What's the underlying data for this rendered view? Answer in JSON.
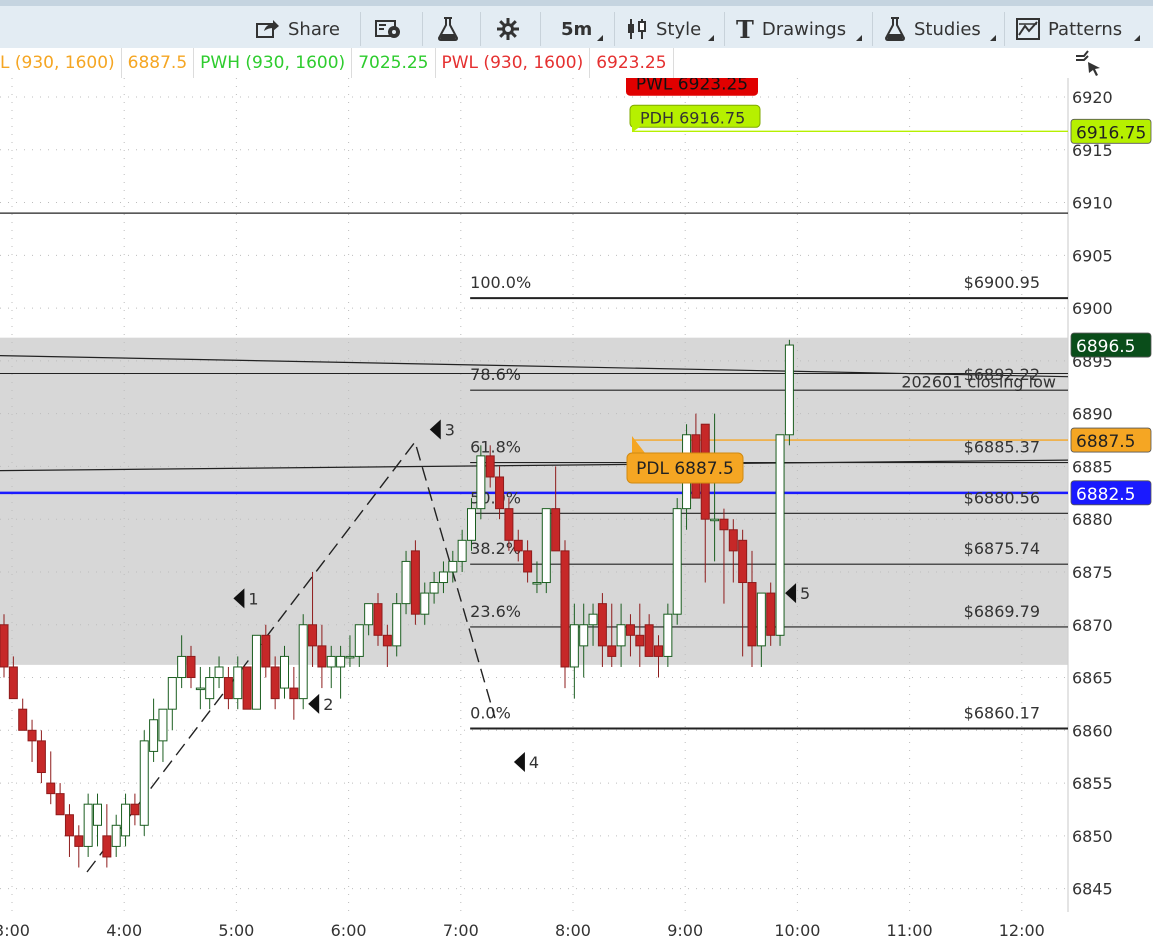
{
  "toolbar": {
    "share": "Share",
    "timeframe": "5m",
    "style": "Style",
    "drawings": "Drawings",
    "studies": "Studies",
    "patterns": "Patterns",
    "icons": [
      "share-icon",
      "screenshot-icon",
      "flask-icon",
      "gear-icon",
      "candles-icon",
      "text-T-icon",
      "flask-icon",
      "patterns-icon"
    ]
  },
  "study_labels": {
    "pdl_label": "L (930, 1600)",
    "pdl_value": "6887.5",
    "pwh_label": "PWH (930, 1600)",
    "pwh_value": "7025.25",
    "pwl_label": "PWL (930, 1600)",
    "pwl_value": "6923.25"
  },
  "colors": {
    "up_candle": "#2e7d32",
    "down_candle": "#c62828",
    "pdl": "#f5a623",
    "pwh": "#b6f000",
    "pwl": "#e00000",
    "blue_line": "#1a1aff",
    "last_price": "#0a4d1a",
    "zone": "#d0d0d0"
  },
  "chart_data": {
    "type": "candlestick",
    "ylim": [
      6843,
      6922
    ],
    "y_ticks": [
      6845,
      6850,
      6855,
      6860,
      6865,
      6870,
      6875,
      6880,
      6885,
      6890,
      6895,
      6900,
      6905,
      6910,
      6915,
      6920
    ],
    "x_ticks": [
      "3:00",
      "4:00",
      "5:00",
      "6:00",
      "7:00",
      "8:00",
      "9:00",
      "10:00",
      "11:00",
      "12:00"
    ],
    "candles": [
      {
        "o": 6870,
        "h": 6871,
        "l": 6865,
        "c": 6866
      },
      {
        "o": 6866,
        "h": 6867,
        "l": 6863,
        "c": 6863
      },
      {
        "o": 6862,
        "h": 6863,
        "l": 6860,
        "c": 6860
      },
      {
        "o": 6860,
        "h": 6861,
        "l": 6857,
        "c": 6859
      },
      {
        "o": 6859,
        "h": 6860,
        "l": 6855,
        "c": 6856
      },
      {
        "o": 6855,
        "h": 6858,
        "l": 6853,
        "c": 6854
      },
      {
        "o": 6854,
        "h": 6855,
        "l": 6852,
        "c": 6852
      },
      {
        "o": 6852,
        "h": 6853,
        "l": 6848,
        "c": 6850
      },
      {
        "o": 6850,
        "h": 6851,
        "l": 6847,
        "c": 6849
      },
      {
        "o": 6849,
        "h": 6854,
        "l": 6848,
        "c": 6853
      },
      {
        "o": 6851,
        "h": 6854,
        "l": 6849,
        "c": 6853
      },
      {
        "o": 6850,
        "h": 6853,
        "l": 6847,
        "c": 6848
      },
      {
        "o": 6849,
        "h": 6852,
        "l": 6848,
        "c": 6851
      },
      {
        "o": 6850,
        "h": 6854,
        "l": 6849,
        "c": 6853
      },
      {
        "o": 6853,
        "h": 6854,
        "l": 6851,
        "c": 6852
      },
      {
        "o": 6851,
        "h": 6860,
        "l": 6850,
        "c": 6859
      },
      {
        "o": 6858,
        "h": 6863,
        "l": 6857,
        "c": 6861
      },
      {
        "o": 6859,
        "h": 6862,
        "l": 6857,
        "c": 6862
      },
      {
        "o": 6862,
        "h": 6865,
        "l": 6860,
        "c": 6865
      },
      {
        "o": 6865,
        "h": 6869,
        "l": 6864,
        "c": 6867
      },
      {
        "o": 6867,
        "h": 6868,
        "l": 6864,
        "c": 6865
      },
      {
        "o": 6864,
        "h": 6866,
        "l": 6862,
        "c": 6864
      },
      {
        "o": 6863,
        "h": 6866,
        "l": 6862,
        "c": 6865
      },
      {
        "o": 6865,
        "h": 6867,
        "l": 6864,
        "c": 6866
      },
      {
        "o": 6865,
        "h": 6866,
        "l": 6862,
        "c": 6863
      },
      {
        "o": 6863,
        "h": 6867,
        "l": 6862,
        "c": 6866
      },
      {
        "o": 6866,
        "h": 6866,
        "l": 6862,
        "c": 6862
      },
      {
        "o": 6862,
        "h": 6869,
        "l": 6862,
        "c": 6869
      },
      {
        "o": 6869,
        "h": 6870,
        "l": 6865,
        "c": 6866
      },
      {
        "o": 6866,
        "h": 6867,
        "l": 6862,
        "c": 6863
      },
      {
        "o": 6864,
        "h": 6868,
        "l": 6863,
        "c": 6867
      },
      {
        "o": 6864,
        "h": 6866,
        "l": 6861,
        "c": 6863
      },
      {
        "o": 6863,
        "h": 6871,
        "l": 6862,
        "c": 6870
      },
      {
        "o": 6870,
        "h": 6875,
        "l": 6866,
        "c": 6868
      },
      {
        "o": 6868,
        "h": 6870,
        "l": 6864,
        "c": 6866
      },
      {
        "o": 6866,
        "h": 6868,
        "l": 6864,
        "c": 6867
      },
      {
        "o": 6866,
        "h": 6868,
        "l": 6863,
        "c": 6867
      },
      {
        "o": 6867,
        "h": 6869,
        "l": 6866,
        "c": 6867
      },
      {
        "o": 6867,
        "h": 6870,
        "l": 6866,
        "c": 6870
      },
      {
        "o": 6870,
        "h": 6872,
        "l": 6869,
        "c": 6872
      },
      {
        "o": 6872,
        "h": 6873,
        "l": 6868,
        "c": 6869
      },
      {
        "o": 6869,
        "h": 6870,
        "l": 6866,
        "c": 6868
      },
      {
        "o": 6868,
        "h": 6873,
        "l": 6867,
        "c": 6872
      },
      {
        "o": 6872,
        "h": 6877,
        "l": 6871,
        "c": 6876
      },
      {
        "o": 6877,
        "h": 6878,
        "l": 6870,
        "c": 6871
      },
      {
        "o": 6871,
        "h": 6874,
        "l": 6870,
        "c": 6873
      },
      {
        "o": 6873,
        "h": 6875,
        "l": 6872,
        "c": 6874
      },
      {
        "o": 6874,
        "h": 6876,
        "l": 6873,
        "c": 6875
      },
      {
        "o": 6875,
        "h": 6877,
        "l": 6874,
        "c": 6876
      },
      {
        "o": 6876,
        "h": 6879,
        "l": 6875,
        "c": 6878
      },
      {
        "o": 6878,
        "h": 6882,
        "l": 6877,
        "c": 6881
      },
      {
        "o": 6881,
        "h": 6887,
        "l": 6880,
        "c": 6886
      },
      {
        "o": 6886,
        "h": 6887,
        "l": 6883,
        "c": 6884
      },
      {
        "o": 6884,
        "h": 6885,
        "l": 6880,
        "c": 6881
      },
      {
        "o": 6881,
        "h": 6882,
        "l": 6877,
        "c": 6878
      },
      {
        "o": 6878,
        "h": 6879,
        "l": 6876,
        "c": 6877
      },
      {
        "o": 6877,
        "h": 6878,
        "l": 6874,
        "c": 6875
      },
      {
        "o": 6874,
        "h": 6876,
        "l": 6873,
        "c": 6874
      },
      {
        "o": 6874,
        "h": 6881,
        "l": 6873,
        "c": 6881
      },
      {
        "o": 6881,
        "h": 6885,
        "l": 6877,
        "c": 6877
      },
      {
        "o": 6877,
        "h": 6878,
        "l": 6864,
        "c": 6866
      },
      {
        "o": 6866,
        "h": 6872,
        "l": 6863,
        "c": 6870
      },
      {
        "o": 6868,
        "h": 6872,
        "l": 6865,
        "c": 6870
      },
      {
        "o": 6870,
        "h": 6872,
        "l": 6868,
        "c": 6871
      },
      {
        "o": 6872,
        "h": 6873,
        "l": 6866,
        "c": 6868
      },
      {
        "o": 6868,
        "h": 6872,
        "l": 6866,
        "c": 6867
      },
      {
        "o": 6868,
        "h": 6872,
        "l": 6866,
        "c": 6870
      },
      {
        "o": 6870,
        "h": 6871,
        "l": 6867,
        "c": 6869
      },
      {
        "o": 6869,
        "h": 6872,
        "l": 6866,
        "c": 6868
      },
      {
        "o": 6870,
        "h": 6871,
        "l": 6867,
        "c": 6867
      },
      {
        "o": 6868,
        "h": 6869,
        "l": 6865,
        "c": 6867
      },
      {
        "o": 6867,
        "h": 6872,
        "l": 6866,
        "c": 6871
      },
      {
        "o": 6871,
        "h": 6882,
        "l": 6870,
        "c": 6881
      },
      {
        "o": 6881,
        "h": 6889,
        "l": 6879,
        "c": 6888
      },
      {
        "o": 6888,
        "h": 6890,
        "l": 6882,
        "c": 6882
      },
      {
        "o": 6889,
        "h": 6889,
        "l": 6874,
        "c": 6880
      },
      {
        "o": 6880,
        "h": 6890,
        "l": 6876,
        "c": 6880
      },
      {
        "o": 6880,
        "h": 6881,
        "l": 6872,
        "c": 6879
      },
      {
        "o": 6879,
        "h": 6880,
        "l": 6874,
        "c": 6877
      },
      {
        "o": 6878,
        "h": 6879,
        "l": 6867,
        "c": 6874
      },
      {
        "o": 6874,
        "h": 6877,
        "l": 6866,
        "c": 6868
      },
      {
        "o": 6868,
        "h": 6873,
        "l": 6866,
        "c": 6873
      },
      {
        "o": 6873,
        "h": 6874,
        "l": 6868,
        "c": 6869
      },
      {
        "o": 6869,
        "h": 6888,
        "l": 6868,
        "c": 6888
      },
      {
        "o": 6888,
        "h": 6897,
        "l": 6887,
        "c": 6896.5
      }
    ],
    "horizontal_lines": [
      {
        "value": 6909,
        "color": "#222222",
        "width": 1.3
      },
      {
        "value": 6916.75,
        "color": "#b6f000",
        "width": 1.3
      },
      {
        "value": 6887.5,
        "color": "#f5a623",
        "width": 1.3
      },
      {
        "value": 6882.5,
        "color": "#1a1aff",
        "width": 2.5
      }
    ],
    "fibonacci": {
      "x_start": "7:05",
      "x_end": "12:05",
      "levels": [
        {
          "pct": "100.0%",
          "price": "$6900.95",
          "value": 6900.95
        },
        {
          "pct": "78.6%",
          "price": "$6892.22",
          "value": 6892.22
        },
        {
          "pct": "61.8%",
          "price": "$6885.37",
          "value": 6885.37
        },
        {
          "pct": "50.0%",
          "price": "$6880.56",
          "value": 6880.56
        },
        {
          "pct": "38.2%",
          "price": "$6875.74",
          "value": 6875.74
        },
        {
          "pct": "23.6%",
          "price": "$6869.79",
          "value": 6869.79
        },
        {
          "pct": "0.0%",
          "price": "$6860.17",
          "value": 6860.17
        }
      ]
    },
    "zone": {
      "low": 6866.2,
      "high": 6897.2
    },
    "trendlines": [
      {
        "y1": 6895.5,
        "y2": 6893.5,
        "label": "202601 closing low"
      },
      {
        "y1": 6884.6,
        "y2": 6885.6,
        "label": ""
      }
    ],
    "pattern_points": [
      {
        "label": "1",
        "time": "5:00",
        "value": 6872.5
      },
      {
        "label": "2",
        "time": "5:40",
        "value": 6862.5
      },
      {
        "label": "3",
        "time": "6:45",
        "value": 6888.5
      },
      {
        "label": "4",
        "time": "7:30",
        "value": 6857.0
      },
      {
        "label": "5",
        "time": "9:55",
        "value": 6873.0
      }
    ],
    "callouts": {
      "pwl": "PWL 6923.25",
      "pdh_hidden": "PDH 6916.75",
      "pdl": "PDL 6887.5"
    },
    "price_badges": {
      "pwh_level": "6916.75",
      "last": "6896.5",
      "pdl_level": "6887.5",
      "blue_level": "6882.5"
    }
  }
}
